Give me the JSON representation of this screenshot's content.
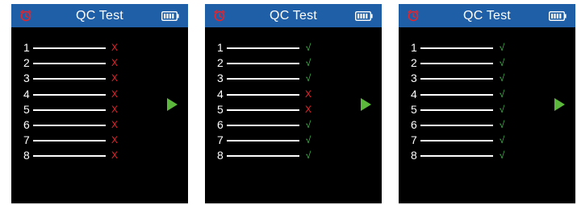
{
  "colors": {
    "header": "#1f5fa8",
    "fail": "#e8232a",
    "pass": "#3fb64a",
    "play": "#5cb83c"
  },
  "icons": {
    "clock": "alarm-clock-icon",
    "battery": "battery-icon",
    "play": "play-arrow-icon"
  },
  "screens": [
    {
      "title": "QC Test",
      "rows": [
        {
          "num": "1",
          "mark": "X"
        },
        {
          "num": "2",
          "mark": "X"
        },
        {
          "num": "3",
          "mark": "X"
        },
        {
          "num": "4",
          "mark": "X"
        },
        {
          "num": "5",
          "mark": "X"
        },
        {
          "num": "6",
          "mark": "X"
        },
        {
          "num": "7",
          "mark": "X"
        },
        {
          "num": "8",
          "mark": "X"
        }
      ]
    },
    {
      "title": "QC Test",
      "rows": [
        {
          "num": "1",
          "mark": "√"
        },
        {
          "num": "2",
          "mark": "√"
        },
        {
          "num": "3",
          "mark": "√"
        },
        {
          "num": "4",
          "mark": "X"
        },
        {
          "num": "5",
          "mark": "X"
        },
        {
          "num": "6",
          "mark": "√"
        },
        {
          "num": "7",
          "mark": "√"
        },
        {
          "num": "8",
          "mark": "√"
        }
      ]
    },
    {
      "title": "QC Test",
      "rows": [
        {
          "num": "1",
          "mark": "√"
        },
        {
          "num": "2",
          "mark": "√"
        },
        {
          "num": "3",
          "mark": "√"
        },
        {
          "num": "4",
          "mark": "√"
        },
        {
          "num": "5",
          "mark": "√"
        },
        {
          "num": "6",
          "mark": "√"
        },
        {
          "num": "7",
          "mark": "√"
        },
        {
          "num": "8",
          "mark": "√"
        }
      ]
    }
  ]
}
